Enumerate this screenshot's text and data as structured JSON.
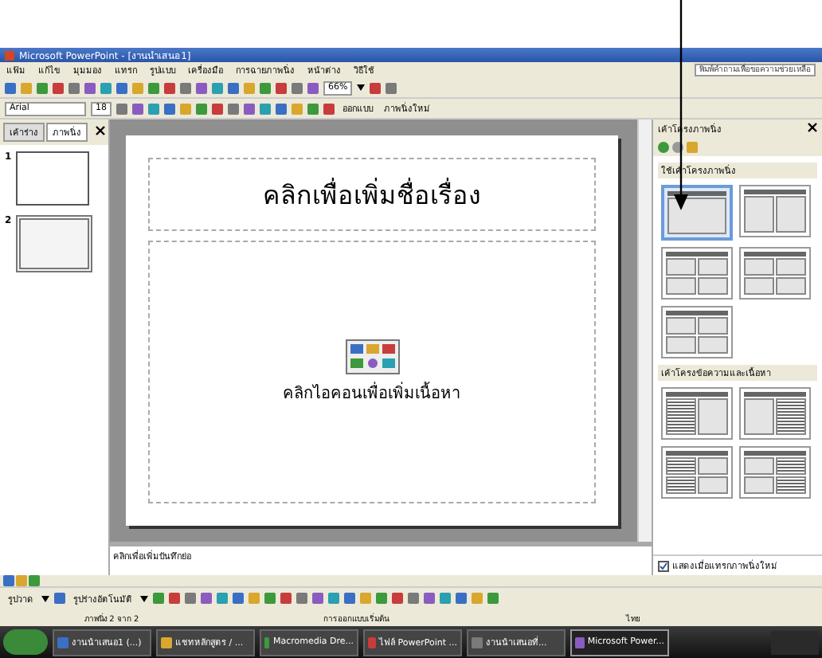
{
  "window": {
    "title": "Microsoft PowerPoint - [งานนำเสนอ1]"
  },
  "menu": [
    "แฟ้ม",
    "แก้ไข",
    "มุมมอง",
    "แทรก",
    "รูปแบบ",
    "เครื่องมือ",
    "การฉายภาพนิ่ง",
    "หน้าต่าง",
    "วิธีใช้"
  ],
  "help_box": {
    "placeholder": "พิมพ์คำถามเพื่อขอความช่วยเหลือ"
  },
  "standard_toolbar": {
    "zoom": "66%"
  },
  "formatting_toolbar": {
    "font": "Arial",
    "size": "18",
    "buttons": [
      "ออกแบบ",
      "ภาพนิ่งใหม่"
    ]
  },
  "pane_tabs": [
    {
      "label": "เค้าร่าง",
      "selected": false
    },
    {
      "label": "ภาพนิ่ง",
      "selected": true
    }
  ],
  "slides": [
    {
      "number": "1",
      "selected": false
    },
    {
      "number": "2",
      "selected": true
    }
  ],
  "slide": {
    "title_placeholder": "คลิกเพื่อเพิ่มชื่อเรื่อง",
    "content_placeholder": "คลิกไอคอนเพื่อเพิ่มเนื้อหา"
  },
  "notes": {
    "placeholder": "คลิกเพื่อเพิ่มบันทึกย่อ"
  },
  "task_pane": {
    "title": "เค้าโครงภาพนิ่ง",
    "sections": [
      {
        "heading": "ใช้เค้าโครงภาพนิ่ง",
        "layouts": [
          {
            "kind": "one",
            "selected": true
          },
          {
            "kind": "two",
            "selected": false
          },
          {
            "kind": "four",
            "selected": false
          },
          {
            "kind": "four",
            "selected": false
          },
          {
            "kind": "four",
            "selected": false
          }
        ]
      },
      {
        "heading": "เค้าโครงข้อความและเนื้อหา",
        "layouts": [
          {
            "kind": "text_one",
            "selected": false
          },
          {
            "kind": "one_text",
            "selected": false
          },
          {
            "kind": "text_two",
            "selected": false
          },
          {
            "kind": "two_text",
            "selected": false
          }
        ]
      }
    ],
    "show_on_insert": {
      "label": "แสดงเมื่อแทรกภาพนิ่งใหม่",
      "checked": true
    }
  },
  "drawing_toolbar": {
    "draw": "รูปวาด",
    "autoshapes": "รูปร่างอัตโนมัติ"
  },
  "status_bar": [
    "ภาพนิ่ง 2 จาก 2",
    "การออกแบบเริ่มต้น",
    "ไทย"
  ],
  "taskbar": [
    {
      "label": "งานนำเสนอ1 (...)",
      "selected": false
    },
    {
      "label": "แชทหลักสูตร / ...",
      "selected": false
    },
    {
      "label": "Macromedia Dre...",
      "selected": false
    },
    {
      "label": "ไฟล์ PowerPoint ...",
      "selected": false
    },
    {
      "label": "งานนำเสนอที่...",
      "selected": false
    },
    {
      "label": "Microsoft Power...",
      "selected": true
    }
  ]
}
